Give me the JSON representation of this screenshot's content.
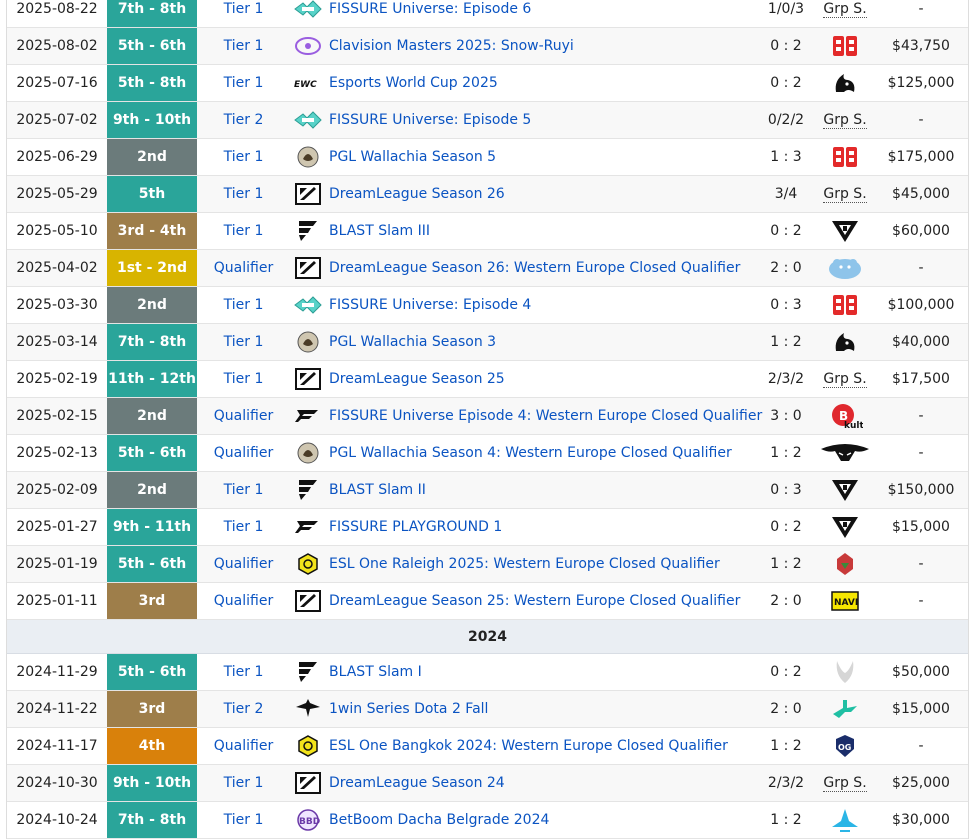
{
  "placement_colors": {
    "teal": "#2aa59a",
    "gray": "#6b7b7b",
    "bronze": "#9e7e4a",
    "gold": "#d8b400",
    "orange": "#d9810b",
    "green": "#339944"
  },
  "rows": [
    {
      "date": "2025-08-22",
      "place": "7th - 8th",
      "place_color": "teal",
      "tier": "Tier 1",
      "icon": "fissure-universe-icon",
      "tournament": "FISSURE Universe: Episode 6",
      "score": "1/0/3",
      "score_grp": false,
      "opp": "group-stage",
      "opp_text": "Grp S.",
      "prize": "-"
    },
    {
      "date": "2025-08-02",
      "place": "5th - 6th",
      "place_color": "teal",
      "tier": "Tier 1",
      "icon": "clavision-icon",
      "tournament": "Clavision Masters 2025: Snow-Ruyi",
      "score": "0 : 2",
      "score_grp": false,
      "opp": "betboom-team-logo",
      "opp_text": "",
      "prize": "$43,750"
    },
    {
      "date": "2025-07-16",
      "place": "5th - 8th",
      "place_color": "teal",
      "tier": "Tier 1",
      "icon": "esports-world-cup-icon",
      "tournament": "Esports World Cup 2025",
      "score": "0 : 2",
      "score_grp": false,
      "opp": "team-spirit-logo",
      "opp_text": "",
      "prize": "$125,000"
    },
    {
      "date": "2025-07-02",
      "place": "9th - 10th",
      "place_color": "teal",
      "tier": "Tier 2",
      "icon": "fissure-universe-icon",
      "tournament": "FISSURE Universe: Episode 5",
      "score": "0/2/2",
      "score_grp": false,
      "opp": "group-stage",
      "opp_text": "Grp S.",
      "prize": "-"
    },
    {
      "date": "2025-06-29",
      "place": "2nd",
      "place_color": "gray",
      "tier": "Tier 1",
      "icon": "pgl-wallachia-icon",
      "tournament": "PGL Wallachia Season 5",
      "score": "1 : 3",
      "score_grp": false,
      "opp": "betboom-team-logo",
      "opp_text": "",
      "prize": "$175,000"
    },
    {
      "date": "2025-05-29",
      "place": "5th",
      "place_color": "teal",
      "tier": "Tier 1",
      "icon": "dreamleague-icon",
      "tournament": "DreamLeague Season 26",
      "score": "3/4",
      "score_grp": false,
      "opp": "group-stage",
      "opp_text": "Grp S.",
      "prize": "$45,000"
    },
    {
      "date": "2025-05-10",
      "place": "3rd - 4th",
      "place_color": "bronze",
      "tier": "Tier 1",
      "icon": "blast-slam-icon",
      "tournament": "BLAST Slam III",
      "score": "0 : 2",
      "score_grp": false,
      "opp": "parivision-logo",
      "opp_text": "",
      "prize": "$60,000"
    },
    {
      "date": "2025-04-02",
      "place": "1st - 2nd",
      "place_color": "gold",
      "tier": "Qualifier",
      "icon": "dreamleague-icon",
      "tournament": "DreamLeague Season 26: Western Europe Closed Qualifier",
      "score": "2 : 0",
      "score_grp": false,
      "opp": "hippo-team-logo",
      "opp_text": "",
      "prize": "-"
    },
    {
      "date": "2025-03-30",
      "place": "2nd",
      "place_color": "gray",
      "tier": "Tier 1",
      "icon": "fissure-universe-icon",
      "tournament": "FISSURE Universe: Episode 4",
      "score": "0 : 3",
      "score_grp": false,
      "opp": "betboom-team-logo",
      "opp_text": "",
      "prize": "$100,000"
    },
    {
      "date": "2025-03-14",
      "place": "7th - 8th",
      "place_color": "teal",
      "tier": "Tier 1",
      "icon": "pgl-wallachia-icon",
      "tournament": "PGL Wallachia Season 3",
      "score": "1 : 2",
      "score_grp": false,
      "opp": "team-spirit-logo",
      "opp_text": "",
      "prize": "$40,000"
    },
    {
      "date": "2025-02-19",
      "place": "11th - 12th",
      "place_color": "teal",
      "tier": "Tier 1",
      "icon": "dreamleague-icon",
      "tournament": "DreamLeague Season 25",
      "score": "2/3/2",
      "score_grp": false,
      "opp": "group-stage",
      "opp_text": "Grp S.",
      "prize": "$17,500"
    },
    {
      "date": "2025-02-15",
      "place": "2nd",
      "place_color": "gray",
      "tier": "Qualifier",
      "icon": "fissure-icon",
      "tournament": "FISSURE Universe Episode 4: Western Europe Closed Qualifier",
      "score": "3 : 0",
      "score_grp": false,
      "opp": "kult-logo",
      "opp_text": "",
      "prize": "-"
    },
    {
      "date": "2025-02-13",
      "place": "5th - 6th",
      "place_color": "teal",
      "tier": "Qualifier",
      "icon": "pgl-wallachia-icon",
      "tournament": "PGL Wallachia Season 4: Western Europe Closed Qualifier",
      "score": "1 : 2",
      "score_grp": false,
      "opp": "team-secret-logo",
      "opp_text": "",
      "prize": "-"
    },
    {
      "date": "2025-02-09",
      "place": "2nd",
      "place_color": "gray",
      "tier": "Tier 1",
      "icon": "blast-slam-icon",
      "tournament": "BLAST Slam II",
      "score": "0 : 3",
      "score_grp": false,
      "opp": "parivision-logo",
      "opp_text": "",
      "prize": "$150,000"
    },
    {
      "date": "2025-01-27",
      "place": "9th - 11th",
      "place_color": "teal",
      "tier": "Tier 1",
      "icon": "fissure-icon",
      "tournament": "FISSURE PLAYGROUND 1",
      "score": "0 : 2",
      "score_grp": false,
      "opp": "parivision-logo",
      "opp_text": "",
      "prize": "$15,000"
    },
    {
      "date": "2025-01-19",
      "place": "5th - 6th",
      "place_color": "teal",
      "tier": "Qualifier",
      "icon": "esl-one-icon",
      "tournament": "ESL One Raleigh 2025: Western Europe Closed Qualifier",
      "score": "1 : 2",
      "score_grp": false,
      "opp": "red-helmet-team-logo",
      "opp_text": "",
      "prize": "-"
    },
    {
      "date": "2025-01-11",
      "place": "3rd",
      "place_color": "bronze",
      "tier": "Qualifier",
      "icon": "dreamleague-icon",
      "tournament": "DreamLeague Season 25: Western Europe Closed Qualifier",
      "score": "2 : 0",
      "score_grp": false,
      "opp": "navi-logo",
      "opp_text": "",
      "prize": "-"
    }
  ],
  "year_divider": "2024",
  "rows_2024": [
    {
      "date": "2024-11-29",
      "place": "5th - 6th",
      "place_color": "teal",
      "tier": "Tier 1",
      "icon": "blast-slam-icon",
      "tournament": "BLAST Slam I",
      "score": "0 : 2",
      "score_grp": false,
      "opp": "wings-team-logo",
      "opp_text": "",
      "prize": "$50,000"
    },
    {
      "date": "2024-11-22",
      "place": "3rd",
      "place_color": "bronze",
      "tier": "Tier 2",
      "icon": "1win-icon",
      "tournament": "1win Series Dota 2 Fall",
      "score": "2 : 0",
      "score_grp": false,
      "opp": "nouns-logo",
      "opp_text": "",
      "prize": "$15,000"
    },
    {
      "date": "2024-11-17",
      "place": "4th",
      "place_color": "orange",
      "tier": "Qualifier",
      "icon": "esl-one-icon",
      "tournament": "ESL One Bangkok 2024: Western Europe Closed Qualifier",
      "score": "1 : 2",
      "score_grp": false,
      "opp": "og-logo",
      "opp_text": "",
      "prize": "-"
    },
    {
      "date": "2024-10-30",
      "place": "9th - 10th",
      "place_color": "teal",
      "tier": "Tier 1",
      "icon": "dreamleague-icon",
      "tournament": "DreamLeague Season 24",
      "score": "2/3/2",
      "score_grp": false,
      "opp": "group-stage",
      "opp_text": "Grp S.",
      "prize": "$25,000"
    },
    {
      "date": "2024-10-24",
      "place": "7th - 8th",
      "place_color": "teal",
      "tier": "Tier 1",
      "icon": "betboom-dacha-icon",
      "tournament": "BetBoom Dacha Belgrade 2024",
      "score": "1 : 2",
      "score_grp": false,
      "opp": "aurora-logo",
      "opp_text": "",
      "prize": "$30,000"
    }
  ]
}
